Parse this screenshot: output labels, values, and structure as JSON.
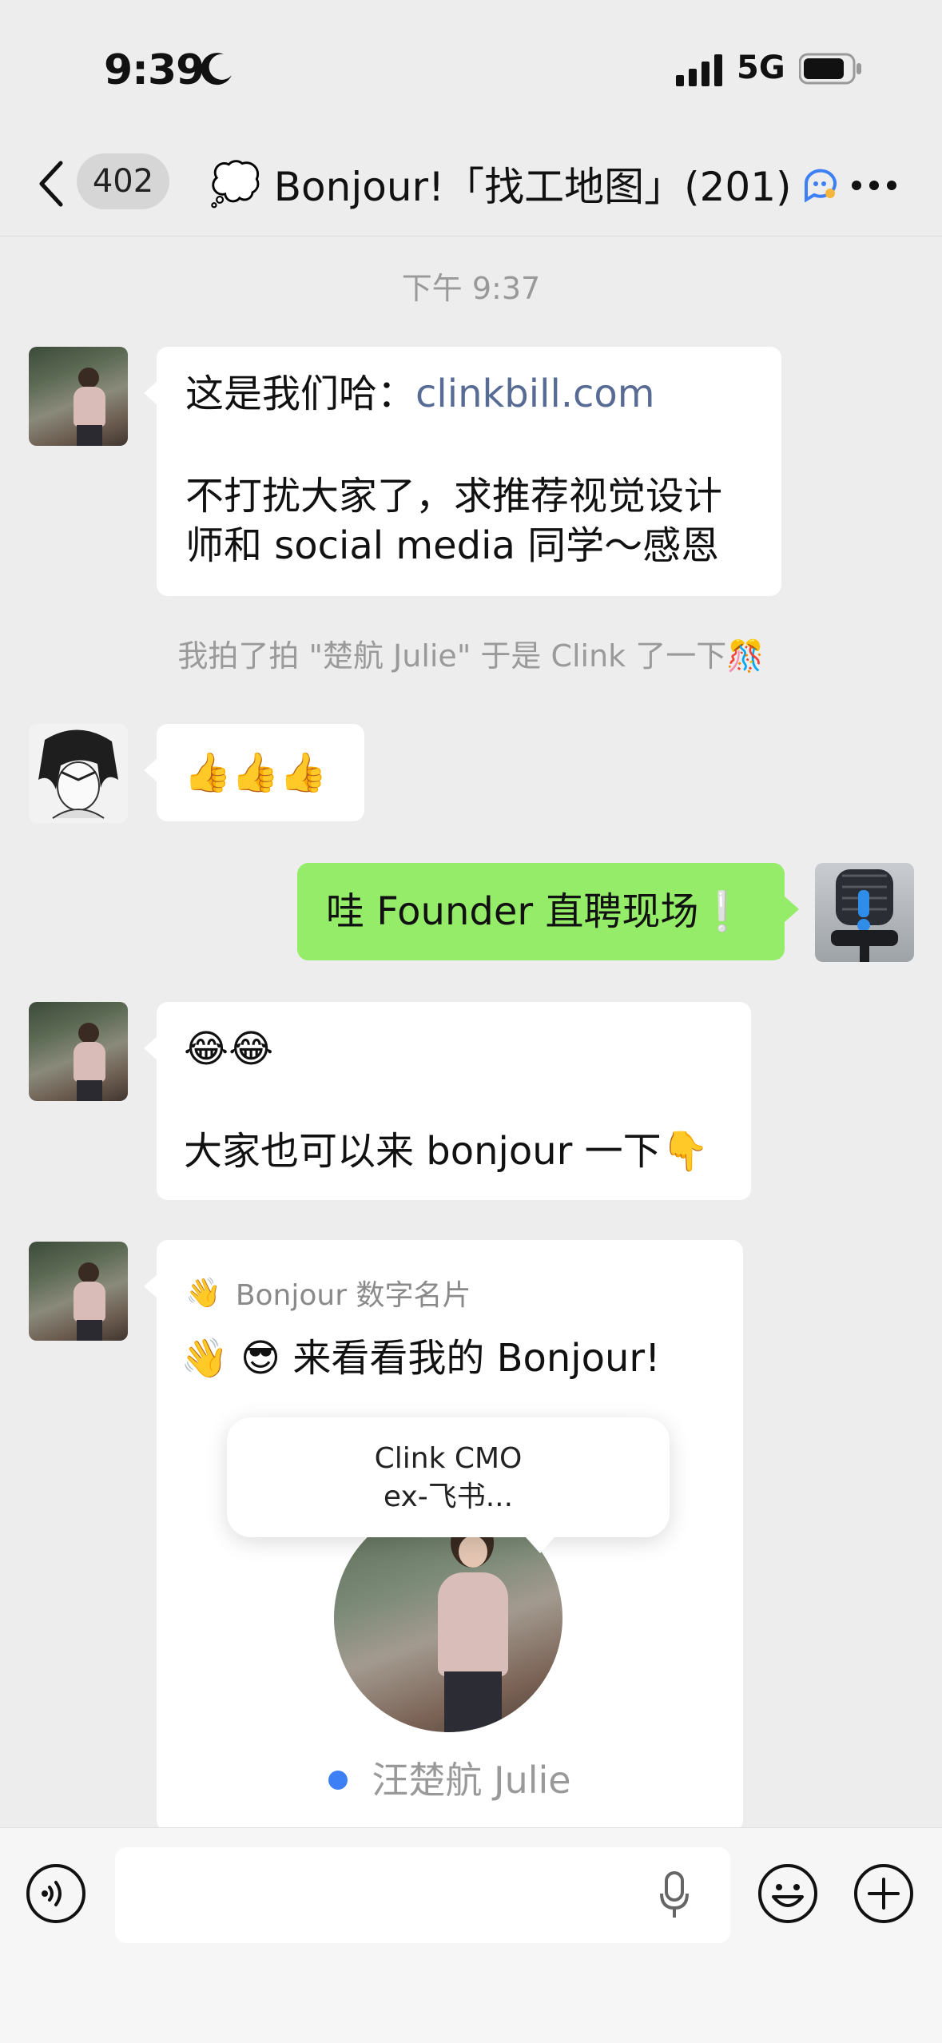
{
  "status_bar": {
    "time": "9:39",
    "network": "5G"
  },
  "nav": {
    "unread_count": "402",
    "title": "Bonjour!「找工地图」(201)",
    "title_emoji": "💭"
  },
  "chat": {
    "timestamp": "下午 9:37",
    "msg1": {
      "prefix": "这是我们哈：",
      "link": "clinkbill.com",
      "line2": "不打扰大家了，求推荐视觉设计",
      "line3": "师和 social media 同学～感恩"
    },
    "system_message": "我拍了拍 \"楚航 Julie\" 于是 Clink 了一下🎊",
    "msg2": {
      "text": "👍👍👍"
    },
    "msg3": {
      "text": "哇 Founder 直聘现场❕"
    },
    "msg4": {
      "line1": "😂😂",
      "line2": "大家也可以来 bonjour 一下👇"
    },
    "card": {
      "header_icon": "👋",
      "header": "Bonjour 数字名片",
      "headline": "👋 😎 来看看我的 Bonjour!",
      "tooltip_line1": "Clink CMO",
      "tooltip_line2": "ex-飞书...",
      "name": "汪楚航 Julie"
    }
  },
  "colors": {
    "background": "#ededed",
    "sent_bubble": "#95ec69",
    "link": "#576b95",
    "dot": "#3d7ff5"
  }
}
